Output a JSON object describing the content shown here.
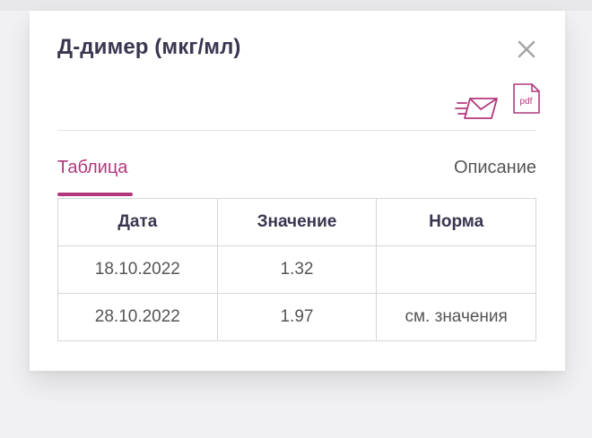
{
  "modal": {
    "title": "Д-димер (мкг/мл)",
    "icons": {
      "close": "close-icon",
      "send_email": "send-email-icon",
      "pdf": "pdf-icon",
      "pdf_label": "pdf"
    }
  },
  "tabs": [
    {
      "label": "Таблица",
      "active": true
    },
    {
      "label": "Описание",
      "active": false
    }
  ],
  "table": {
    "headers": [
      "Дата",
      "Значение",
      "Норма"
    ],
    "rows": [
      [
        "18.10.2022",
        "1.32",
        ""
      ],
      [
        "28.10.2022",
        "1.97",
        "см. значения"
      ]
    ]
  },
  "colors": {
    "accent": "#b2387c",
    "title": "#3b3650",
    "text": "#555555",
    "icon_gray": "#a6a6a6"
  }
}
